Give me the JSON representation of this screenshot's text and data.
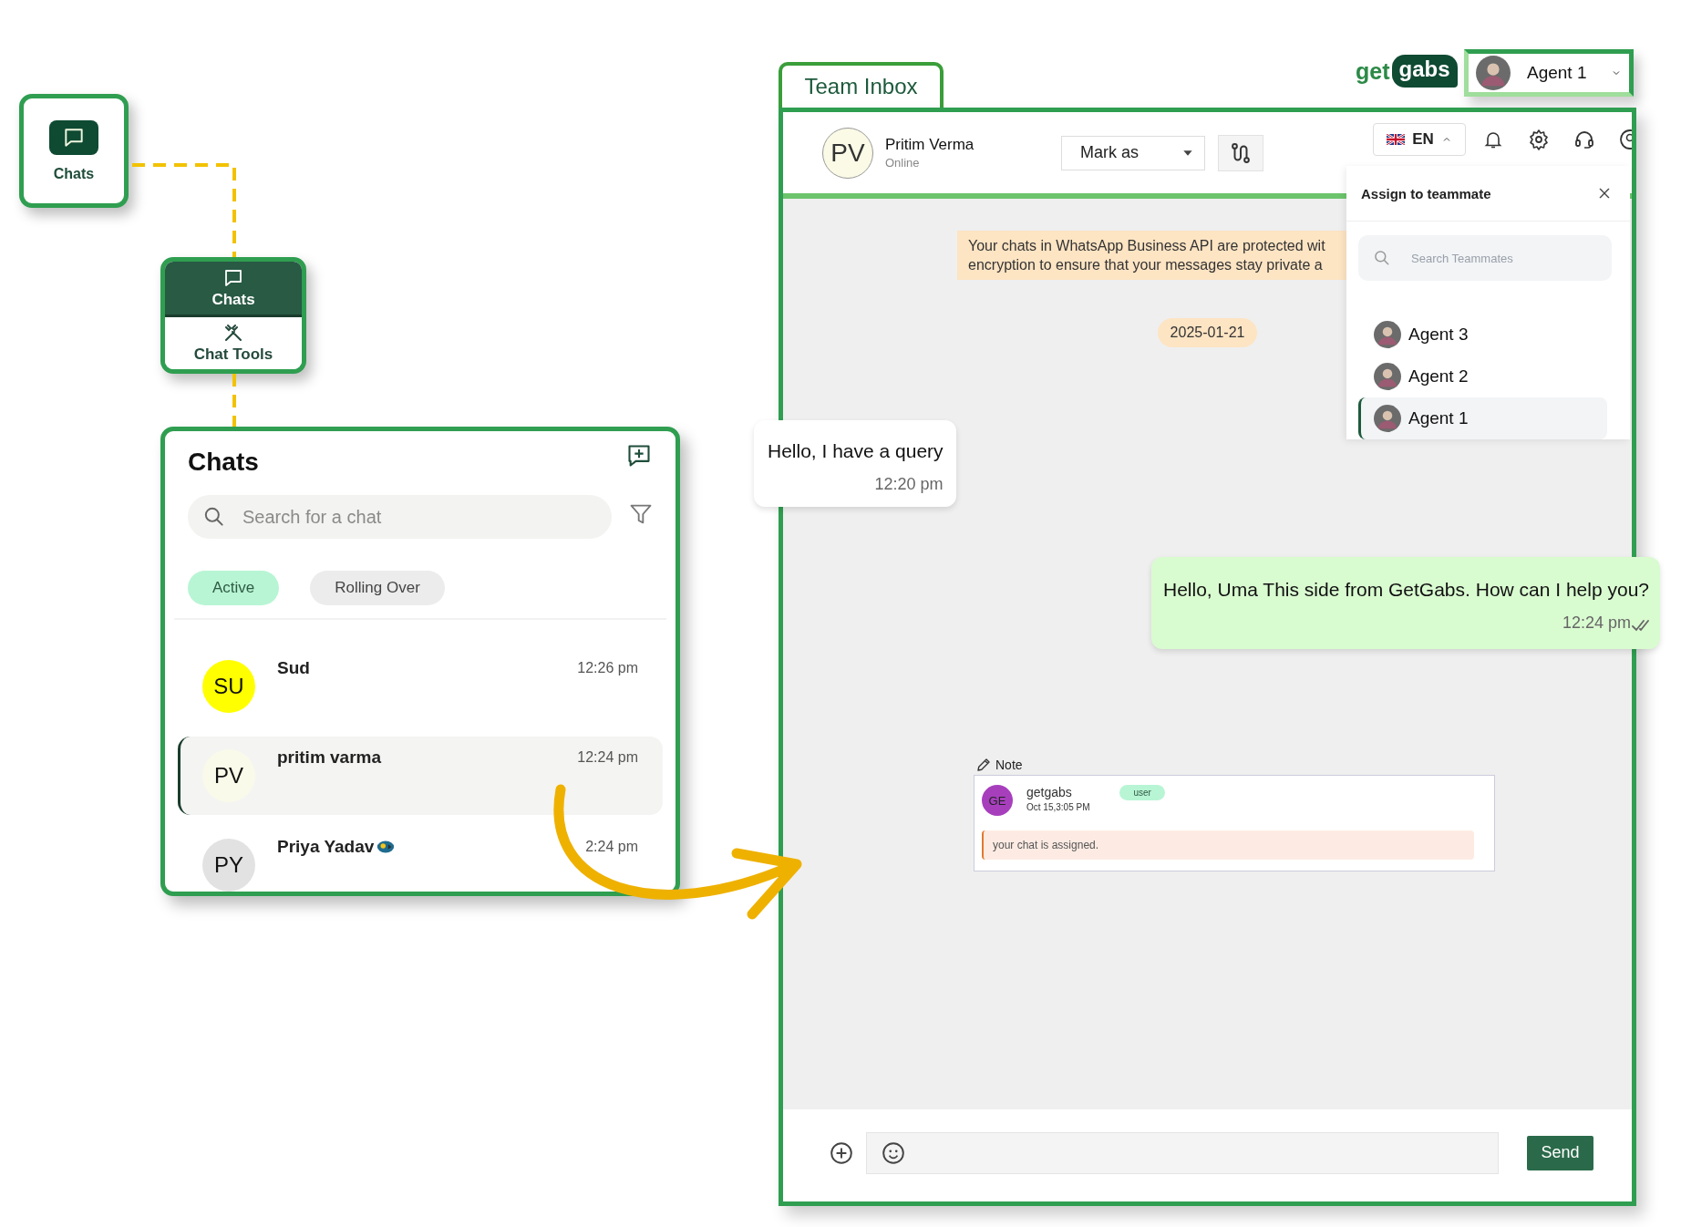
{
  "nav_tile": {
    "label": "Chats",
    "selected": true
  },
  "menu_tile": {
    "items": [
      {
        "label": "Chats",
        "kind": "chat",
        "selected": true
      },
      {
        "label": "Chat Tools",
        "kind": "tools",
        "selected": false
      }
    ]
  },
  "chat_list": {
    "title": "Chats",
    "search": {
      "placeholder": "Search for a chat"
    },
    "filters": [
      {
        "label": "Active",
        "selected": true
      },
      {
        "label": "Rolling Over",
        "selected": false
      }
    ],
    "chats": [
      {
        "initials": "SU",
        "name": "Sud",
        "time": "12:26 pm",
        "color": "#ffff00",
        "selected": false,
        "emoji": false
      },
      {
        "initials": "PV",
        "name": "pritim varma",
        "time": "12:24 pm",
        "color": "#fafaea",
        "selected": true,
        "emoji": false
      },
      {
        "initials": "PY",
        "name": "Priya Yadav",
        "time": "2:24 pm",
        "color": "#e2e2e2",
        "selected": false,
        "emoji": true
      }
    ]
  },
  "inbox": {
    "tab": "Team Inbox",
    "logo": {
      "prefix": "get",
      "badge": "gabs"
    },
    "agent_menu": {
      "name": "Agent 1"
    },
    "contact": {
      "initials": "PV",
      "name": "Pritim Verma",
      "status": "Online"
    },
    "mark_as": "Mark as",
    "language": "EN",
    "banner": [
      "Your chats in WhatsApp Business API are protected wit",
      "encryption to ensure that your messages stay private a"
    ],
    "date": "2025-01-21",
    "messages": [
      {
        "kind": "incoming",
        "text": "Hello, I have a query",
        "time": "12:20 pm",
        "read": false
      },
      {
        "kind": "outgoing",
        "text": "Hello, Uma This side from GetGabs. How can I help you?",
        "time": "12:24 pm",
        "read": true
      }
    ],
    "note": {
      "label": "Note",
      "initials": "GE",
      "author": "getgabs",
      "role": "user",
      "timestamp": "Oct 15,3:05 PM",
      "text": "your chat is assigned."
    },
    "composer": {
      "send": "Send"
    }
  },
  "assign_panel": {
    "title": "Assign to teammate",
    "search": {
      "placeholder": "Search Teammates"
    },
    "teammates": [
      {
        "name": "Agent 3",
        "selected": false
      },
      {
        "name": "Agent 2",
        "selected": false
      },
      {
        "name": "Agent 1",
        "selected": true
      }
    ]
  }
}
